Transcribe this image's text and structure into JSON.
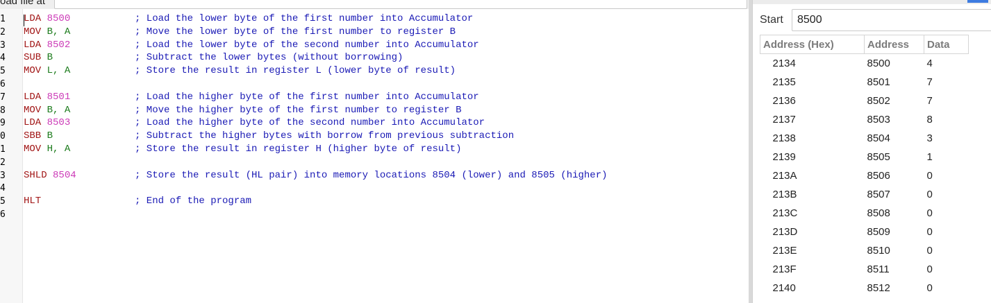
{
  "topbar": {
    "label": "oad file at"
  },
  "editor": {
    "line_numbers": [
      "1",
      "2",
      "3",
      "4",
      "5",
      "6",
      "7",
      "8",
      "9",
      "0",
      "1",
      "2",
      "3",
      "4",
      "5",
      "6"
    ],
    "lines": [
      {
        "mn": "LDA",
        "sep": " ",
        "ops": [
          {
            "t": "8500",
            "k": "num"
          }
        ],
        "comment": "; Load the lower byte of the first number into Accumulator"
      },
      {
        "mn": "MOV",
        "sep": " ",
        "ops": [
          {
            "t": "B, A",
            "k": "reg"
          }
        ],
        "comment": "; Move the lower byte of the first number to register B"
      },
      {
        "mn": "LDA",
        "sep": " ",
        "ops": [
          {
            "t": "8502",
            "k": "num"
          }
        ],
        "comment": "; Load the lower byte of the second number into Accumulator"
      },
      {
        "mn": "SUB",
        "sep": " ",
        "ops": [
          {
            "t": "B",
            "k": "reg"
          }
        ],
        "comment": "; Subtract the lower bytes (without borrowing)"
      },
      {
        "mn": "MOV",
        "sep": " ",
        "ops": [
          {
            "t": "L, A",
            "k": "reg"
          }
        ],
        "comment": "; Store the result in register L (lower byte of result)"
      },
      {
        "mn": "",
        "sep": "",
        "ops": [],
        "comment": ""
      },
      {
        "mn": "LDA",
        "sep": " ",
        "ops": [
          {
            "t": "8501",
            "k": "num"
          }
        ],
        "comment": "; Load the higher byte of the first number into Accumulator"
      },
      {
        "mn": "MOV",
        "sep": " ",
        "ops": [
          {
            "t": "B, A",
            "k": "reg"
          }
        ],
        "comment": "; Move the higher byte of the first number to register B"
      },
      {
        "mn": "LDA",
        "sep": " ",
        "ops": [
          {
            "t": "8503",
            "k": "num"
          }
        ],
        "comment": "; Load the higher byte of the second number into Accumulator"
      },
      {
        "mn": "SBB",
        "sep": " ",
        "ops": [
          {
            "t": "B",
            "k": "reg"
          }
        ],
        "comment": "; Subtract the higher bytes with borrow from previous subtraction"
      },
      {
        "mn": "MOV",
        "sep": " ",
        "ops": [
          {
            "t": "H, A",
            "k": "reg"
          }
        ],
        "comment": "; Store the result in register H (higher byte of result)"
      },
      {
        "mn": "",
        "sep": "",
        "ops": [],
        "comment": ""
      },
      {
        "mn": "SHLD",
        "sep": " ",
        "ops": [
          {
            "t": "8504",
            "k": "num"
          }
        ],
        "comment": "; Store the result (HL pair) into memory locations 8504 (lower) and 8505 (higher)"
      },
      {
        "mn": "",
        "sep": "",
        "ops": [],
        "comment": ""
      },
      {
        "mn": "HLT",
        "sep": "",
        "ops": [],
        "comment": "; End of the program"
      },
      {
        "mn": "",
        "sep": "",
        "ops": [],
        "comment": ""
      }
    ]
  },
  "memory": {
    "start_label": "Start",
    "start_value": "8500",
    "columns": [
      "Address (Hex)",
      "Address",
      "Data"
    ],
    "rows": [
      [
        "2134",
        "8500",
        "4"
      ],
      [
        "2135",
        "8501",
        "7"
      ],
      [
        "2136",
        "8502",
        "7"
      ],
      [
        "2137",
        "8503",
        "8"
      ],
      [
        "2138",
        "8504",
        "3"
      ],
      [
        "2139",
        "8505",
        "1"
      ],
      [
        "213A",
        "8506",
        "0"
      ],
      [
        "213B",
        "8507",
        "0"
      ],
      [
        "213C",
        "8508",
        "0"
      ],
      [
        "213D",
        "8509",
        "0"
      ],
      [
        "213E",
        "8510",
        "0"
      ],
      [
        "213F",
        "8511",
        "0"
      ],
      [
        "2140",
        "8512",
        "0"
      ]
    ]
  }
}
